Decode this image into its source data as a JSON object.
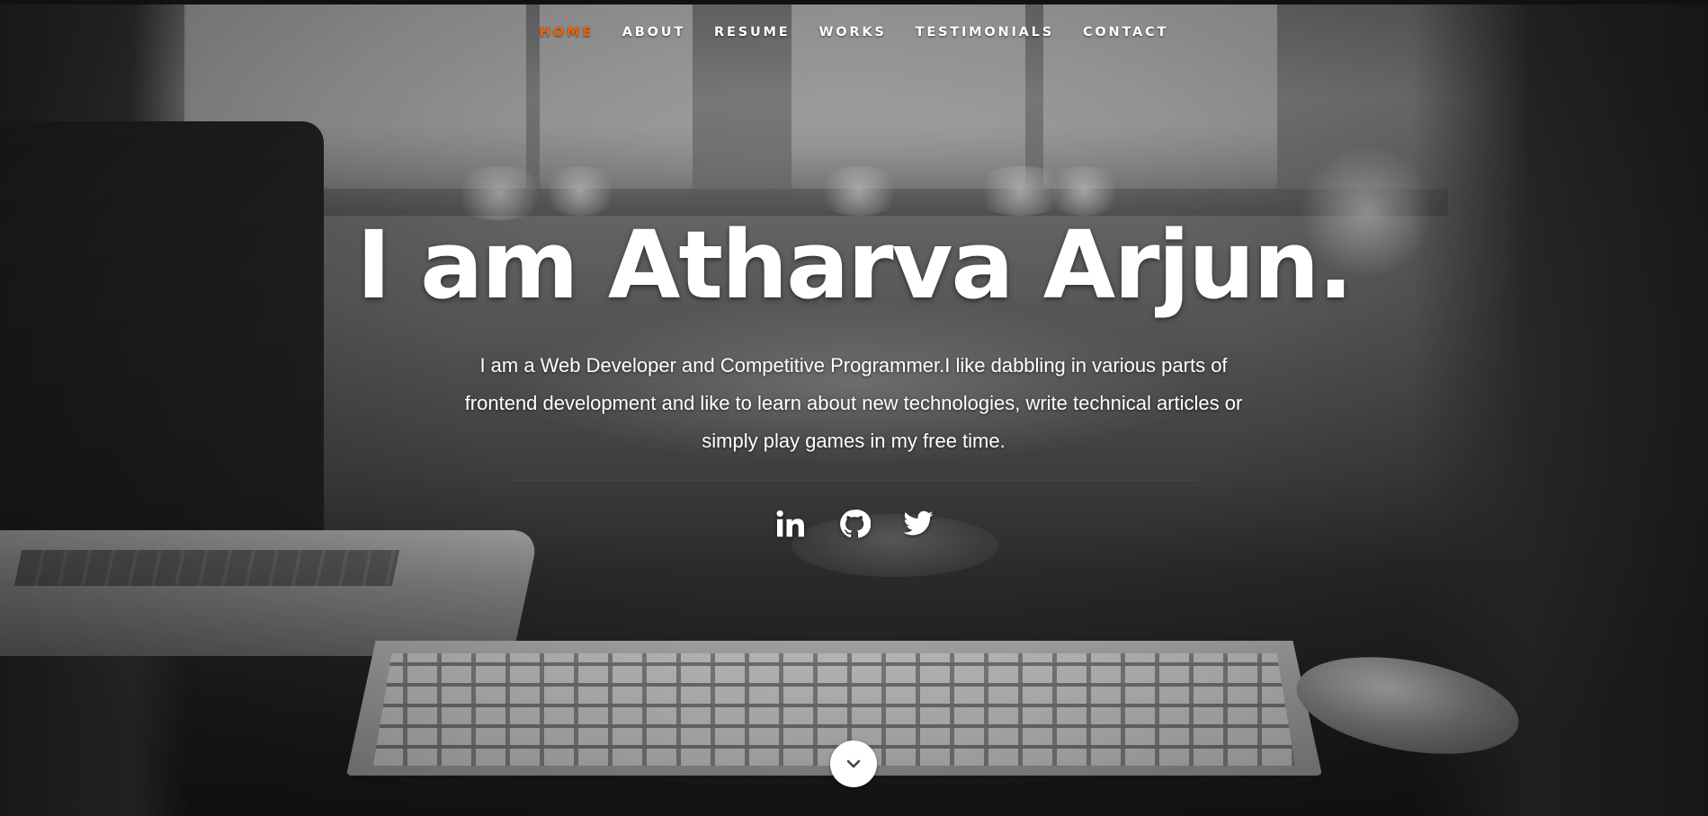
{
  "nav": {
    "items": [
      {
        "label": "HOME",
        "active": true
      },
      {
        "label": "ABOUT",
        "active": false
      },
      {
        "label": "RESUME",
        "active": false
      },
      {
        "label": "WORKS",
        "active": false
      },
      {
        "label": "TESTIMONIALS",
        "active": false
      },
      {
        "label": "CONTACT",
        "active": false
      }
    ]
  },
  "hero": {
    "headline": "I am Atharva Arjun.",
    "tagline": "I am a Web Developer and Competitive Programmer.I like dabbling in various parts of frontend development and like to learn about new technologies, write technical articles or simply play games in my free time."
  },
  "social": [
    {
      "icon": "linkedin-icon"
    },
    {
      "icon": "github-icon"
    },
    {
      "icon": "twitter-icon"
    }
  ],
  "scroll_down": {
    "icon": "chevron-down-icon"
  },
  "colors": {
    "accent": "#f06000",
    "text": "#ffffff"
  }
}
